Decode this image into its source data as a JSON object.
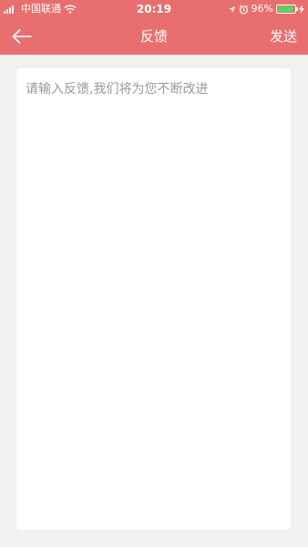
{
  "status_bar": {
    "carrier": "中国联通",
    "time": "20:19",
    "battery_percent_text": "96%",
    "battery_level": 0.96,
    "icons": [
      "signal-icon",
      "wifi-icon",
      "location-icon",
      "alarm-icon",
      "battery-icon",
      "charging-icon"
    ]
  },
  "nav": {
    "title": "反馈",
    "send_label": "发送",
    "back_icon": "arrow-left-icon"
  },
  "form": {
    "placeholder": "请输入反馈,我们将为您不断改进",
    "value": ""
  },
  "colors": {
    "header_bg": "#e96f6f",
    "page_bg": "#f1f1f1",
    "card_bg": "#ffffff",
    "placeholder_text": "#999999",
    "battery_fill": "#4cd964"
  }
}
